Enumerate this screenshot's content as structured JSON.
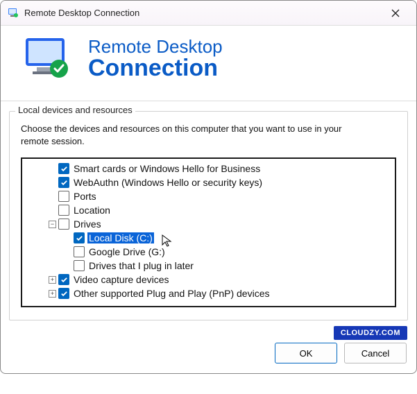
{
  "titlebar": {
    "title": "Remote Desktop Connection"
  },
  "header": {
    "line1": "Remote Desktop",
    "line2": "Connection"
  },
  "group": {
    "legend": "Local devices and resources",
    "description": "Choose the devices and resources on this computer that you want to use in your remote session."
  },
  "tree": {
    "items": [
      {
        "label": "Smart cards or Windows Hello for Business"
      },
      {
        "label": "WebAuthn (Windows Hello or security keys)"
      },
      {
        "label": "Ports"
      },
      {
        "label": "Location"
      },
      {
        "label": "Drives"
      },
      {
        "label": "Local Disk (C:)"
      },
      {
        "label": "Google Drive (G:)"
      },
      {
        "label": "Drives that I plug in later"
      },
      {
        "label": "Video capture devices"
      },
      {
        "label": "Other supported Plug and Play (PnP) devices"
      }
    ]
  },
  "footer": {
    "ok": "OK",
    "cancel": "Cancel"
  },
  "badge": "CLOUDZY.COM"
}
